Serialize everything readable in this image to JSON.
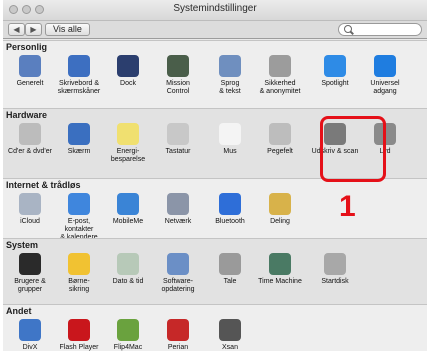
{
  "window": {
    "title": "Systemindstillinger"
  },
  "toolbar": {
    "back": "◀",
    "forward": "▶",
    "show_all": "Vis alle",
    "search_placeholder": ""
  },
  "sections": [
    {
      "title": "Personlig",
      "items": [
        {
          "label": "Generelt",
          "icon": "general-icon",
          "color": "#5a7fbf"
        },
        {
          "label": "Skrivebord &\nskærmskåner",
          "icon": "desktop-icon",
          "color": "#3d6fc1"
        },
        {
          "label": "Dock",
          "icon": "dock-icon",
          "color": "#2b3e6e"
        },
        {
          "label": "Mission\nControl",
          "icon": "mission-control-icon",
          "color": "#4a5e4a"
        },
        {
          "label": "Sprog\n& tekst",
          "icon": "language-icon",
          "color": "#6f8fbf"
        },
        {
          "label": "Sikkerhed\n& anonymitet",
          "icon": "security-icon",
          "color": "#9c9c9c"
        },
        {
          "label": "Spotlight",
          "icon": "spotlight-icon",
          "color": "#2e8be6"
        },
        {
          "label": "Universel\nadgang",
          "icon": "accessibility-icon",
          "color": "#1f7de0"
        }
      ]
    },
    {
      "title": "Hardware",
      "items": [
        {
          "label": "Cd'er & dvd'er",
          "icon": "cd-icon",
          "color": "#bcbcbc"
        },
        {
          "label": "Skærm",
          "icon": "display-icon",
          "color": "#3a6fc0"
        },
        {
          "label": "Energi-\nbesparelse",
          "icon": "energy-icon",
          "color": "#f0e070"
        },
        {
          "label": "Tastatur",
          "icon": "keyboard-icon",
          "color": "#c8c8c8"
        },
        {
          "label": "Mus",
          "icon": "mouse-icon",
          "color": "#f4f4f4"
        },
        {
          "label": "Pegefelt",
          "icon": "trackpad-icon",
          "color": "#bdbdbd"
        },
        {
          "label": "Udskriv & scan",
          "icon": "printer-icon",
          "color": "#7a7a7a"
        },
        {
          "label": "Lyd",
          "icon": "sound-icon",
          "color": "#8a8a8a"
        }
      ]
    },
    {
      "title": "Internet & trådløs",
      "items": [
        {
          "label": "iCloud",
          "icon": "icloud-icon",
          "color": "#a9b4c4"
        },
        {
          "label": "E-post, kontakter\n& kalendere",
          "icon": "mail-icon",
          "color": "#3f86dd"
        },
        {
          "label": "MobileMe",
          "icon": "mobileme-icon",
          "color": "#3a84d6"
        },
        {
          "label": "Netværk",
          "icon": "network-icon",
          "color": "#8b95a8"
        },
        {
          "label": "Bluetooth",
          "icon": "bluetooth-icon",
          "color": "#2e6ed8"
        },
        {
          "label": "Deling",
          "icon": "sharing-icon",
          "color": "#d8b24a"
        }
      ]
    },
    {
      "title": "System",
      "items": [
        {
          "label": "Brugere &\ngrupper",
          "icon": "users-icon",
          "color": "#2a2a2a"
        },
        {
          "label": "Børne-\nsikring",
          "icon": "parental-icon",
          "color": "#f1c232"
        },
        {
          "label": "Dato & tid",
          "icon": "clock-icon",
          "color": "#b7c9b8"
        },
        {
          "label": "Software-\nopdatering",
          "icon": "software-update-icon",
          "color": "#6b8fc6"
        },
        {
          "label": "Tale",
          "icon": "microphone-icon",
          "color": "#9a9a9a"
        },
        {
          "label": "Time Machine",
          "icon": "time-machine-icon",
          "color": "#4a7a64"
        },
        {
          "label": "Startdisk",
          "icon": "startup-disk-icon",
          "color": "#a8a8a8"
        }
      ]
    },
    {
      "title": "Andet",
      "items": [
        {
          "label": "DivX",
          "icon": "divx-icon",
          "color": "#3f76c7"
        },
        {
          "label": "Flash Player",
          "icon": "flash-icon",
          "color": "#c9161c"
        },
        {
          "label": "Flip4Mac",
          "icon": "flip4mac-icon",
          "color": "#6aa23e"
        },
        {
          "label": "Perian",
          "icon": "perian-icon",
          "color": "#c62828"
        },
        {
          "label": "Xsan",
          "icon": "xsan-icon",
          "color": "#555555"
        }
      ]
    }
  ],
  "annotation": {
    "marker": "1",
    "color": "#e51018"
  }
}
